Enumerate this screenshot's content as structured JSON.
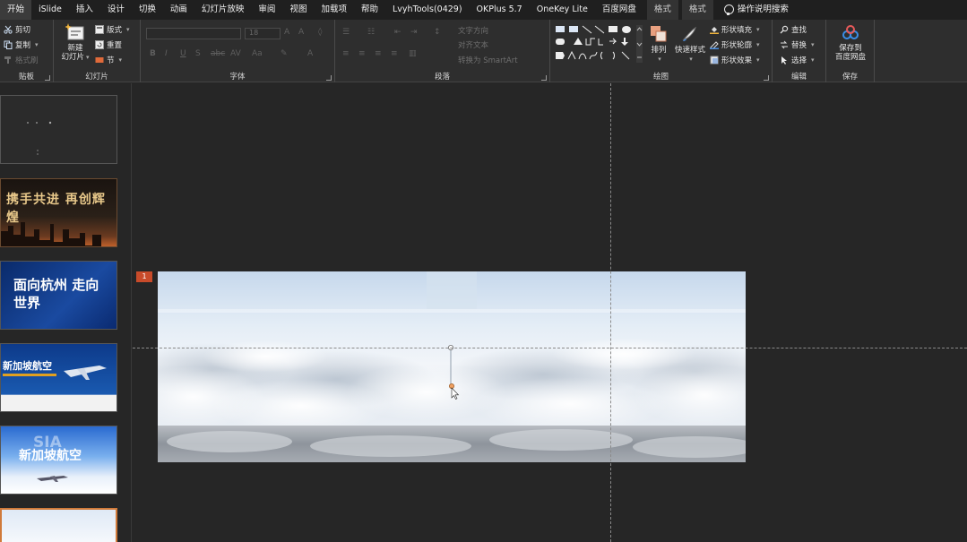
{
  "tabs": [
    {
      "label": "开始",
      "active": true
    },
    {
      "label": "iSlide"
    },
    {
      "label": "插入"
    },
    {
      "label": "设计"
    },
    {
      "label": "切换"
    },
    {
      "label": "动画"
    },
    {
      "label": "幻灯片放映"
    },
    {
      "label": "审阅"
    },
    {
      "label": "视图"
    },
    {
      "label": "加载项"
    },
    {
      "label": "帮助"
    },
    {
      "label": "LvyhTools(0429)"
    },
    {
      "label": "OKPlus 5.7"
    },
    {
      "label": "OneKey Lite"
    },
    {
      "label": "百度网盘"
    }
  ],
  "context_tabs": [
    "格式",
    "格式"
  ],
  "search_label": "操作说明搜索",
  "ribbon": {
    "clipboard": {
      "label": "贴板",
      "cut": "剪切",
      "copy": "复制",
      "format_painter": "格式刷"
    },
    "slides": {
      "label": "幻灯片",
      "new_slide": "新建",
      "new_slide_2": "幻灯片",
      "layout": "版式",
      "reset": "重置",
      "section": "节"
    },
    "font": {
      "label": "字体",
      "size": "18"
    },
    "paragraph": {
      "label": "段落",
      "text_direction": "文字方向",
      "align_text": "对齐文本",
      "smartart": "转换为 SmartArt"
    },
    "drawing": {
      "label": "绘图",
      "arrange": "排列",
      "quick_styles": "快速样式",
      "shape_fill": "形状填充",
      "shape_outline": "形状轮廓",
      "shape_effects": "形状效果"
    },
    "editing": {
      "label": "编辑",
      "find": "查找",
      "replace": "替换",
      "select": "选择"
    },
    "save": {
      "label": "保存",
      "save_to": "保存到",
      "baidu": "百度网盘"
    }
  },
  "thumbnails": [
    {
      "title": "",
      "theme": "dark-grey"
    },
    {
      "title": "携手共进 再创辉煌",
      "theme": "gold-city"
    },
    {
      "title": "面向杭州 走向世界",
      "theme": "blue-brush"
    },
    {
      "title": "新加坡航空",
      "theme": "blue-plane"
    },
    {
      "title": "新加坡航空",
      "theme": "sky-plane",
      "watermark": "SIA"
    },
    {
      "title": "",
      "theme": "sky-selected"
    }
  ],
  "slide_number": "1",
  "colors": {
    "accent": "#c84b2a",
    "ribbon_bg": "#2e2e2e",
    "tab_bg": "#1f1f1f",
    "workspace": "#262626"
  }
}
